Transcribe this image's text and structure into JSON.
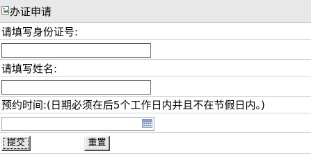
{
  "header": {
    "title": "办证申请",
    "icon": "broken-image-icon"
  },
  "form": {
    "id_label": "请填写身份证号:",
    "id_value": "",
    "name_label": "请填写姓名:",
    "name_value": "",
    "date_label": "预约时间:(日期必须在后5个工作日内并且不在节假日内。)",
    "date_value": "",
    "calendar_icon": "calendar-icon",
    "submit_label": "提交",
    "reset_label": "重置"
  }
}
